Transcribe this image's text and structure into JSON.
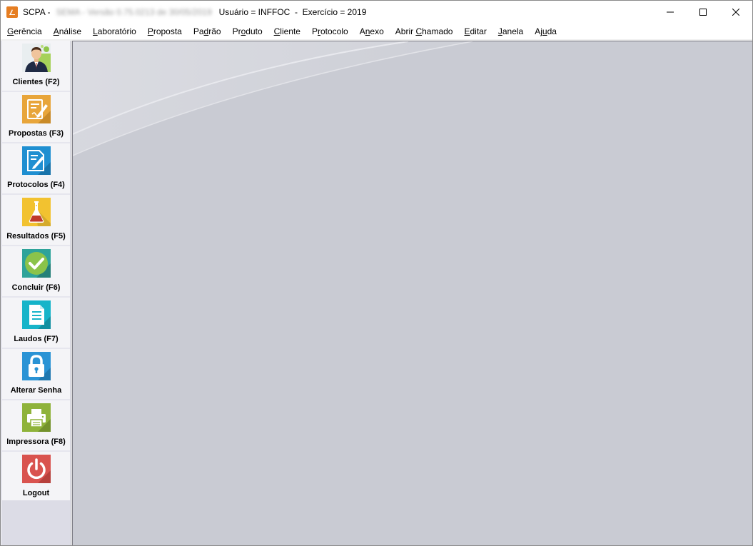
{
  "window": {
    "app_name": "SCPA -",
    "blurred_text": "SEMA - Versão 0.75.0213 de 30/05/2019",
    "info": "Usuário = INFFOC  -  Exercício = 2019"
  },
  "menu": [
    {
      "pre": "",
      "u": "G",
      "post": "erência"
    },
    {
      "pre": "",
      "u": "A",
      "post": "nálise"
    },
    {
      "pre": "",
      "u": "L",
      "post": "aboratório"
    },
    {
      "pre": "",
      "u": "P",
      "post": "roposta"
    },
    {
      "pre": "Pa",
      "u": "d",
      "post": "rão"
    },
    {
      "pre": "Pr",
      "u": "o",
      "post": "duto"
    },
    {
      "pre": "",
      "u": "C",
      "post": "liente"
    },
    {
      "pre": "P",
      "u": "r",
      "post": "otocolo"
    },
    {
      "pre": "A",
      "u": "n",
      "post": "exo"
    },
    {
      "pre": "Abrir ",
      "u": "C",
      "post": "hamado"
    },
    {
      "pre": "",
      "u": "E",
      "post": "ditar"
    },
    {
      "pre": "",
      "u": "J",
      "post": "anela"
    },
    {
      "pre": "Aj",
      "u": "u",
      "post": "da"
    }
  ],
  "sidebar": [
    {
      "label": "Clientes (F2)",
      "icon": "client-person-icon"
    },
    {
      "label": "Propostas (F3)",
      "icon": "proposal-edit-icon"
    },
    {
      "label": "Protocolos (F4)",
      "icon": "protocol-document-icon"
    },
    {
      "label": "Resultados (F5)",
      "icon": "lab-flask-icon"
    },
    {
      "label": "Concluir (F6)",
      "icon": "checkmark-icon"
    },
    {
      "label": "Laudos (F7)",
      "icon": "report-document-icon"
    },
    {
      "label": "Alterar Senha",
      "icon": "padlock-icon"
    },
    {
      "label": "Impressora (F8)",
      "icon": "printer-icon"
    },
    {
      "label": "Logout",
      "icon": "power-icon"
    }
  ],
  "colors": {
    "mdi_background": "#c9cbd3",
    "sidebar_background": "#e6e6ee",
    "icon_orange": "#e8a53a",
    "icon_blue": "#1f8fd1",
    "icon_yellow": "#f2c230",
    "icon_teal": "#2ea39a",
    "icon_green": "#8fb33a",
    "icon_red": "#d9534f"
  }
}
